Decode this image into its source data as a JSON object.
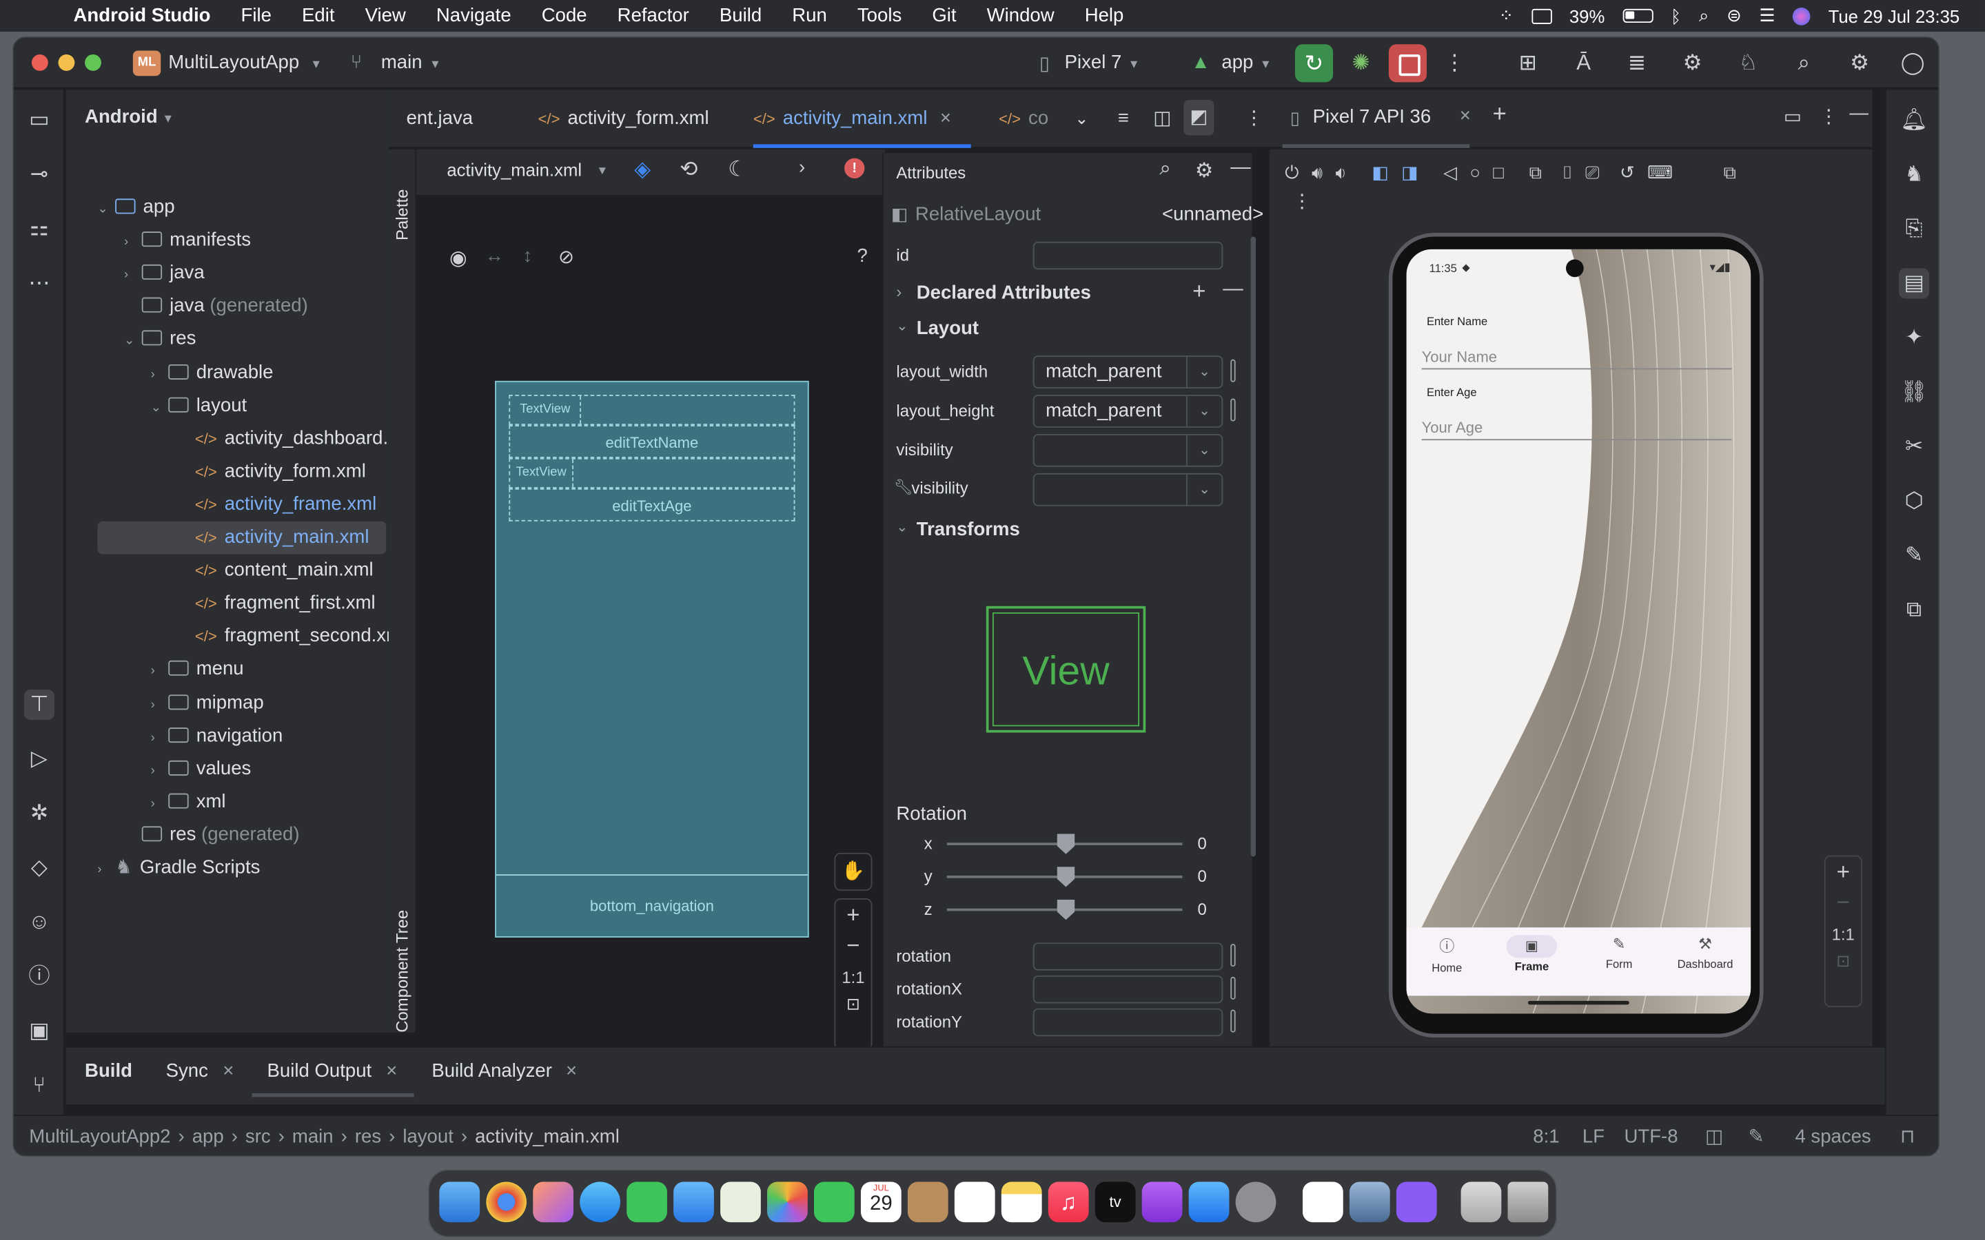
{
  "menubar": {
    "app_name": "Android Studio",
    "items": [
      "File",
      "Edit",
      "View",
      "Navigate",
      "Code",
      "Refactor",
      "Build",
      "Run",
      "Tools",
      "Git",
      "Window",
      "Help"
    ],
    "battery": "39%",
    "datetime": "Tue 29 Jul  23:35"
  },
  "titlebar": {
    "project_badge": "ML",
    "project_name": "MultiLayoutApp",
    "branch": "main",
    "device": "Pixel 7",
    "run_config": "app"
  },
  "project": {
    "view_mode": "Android",
    "tree": [
      {
        "label": "app",
        "indent": 0,
        "arrow": "open",
        "kind": "module"
      },
      {
        "label": "manifests",
        "indent": 1,
        "arrow": "closed",
        "kind": "folder"
      },
      {
        "label": "java",
        "indent": 1,
        "arrow": "closed",
        "kind": "folder"
      },
      {
        "label": "java",
        "suffix": " (generated)",
        "indent": 1,
        "arrow": "none",
        "kind": "folder"
      },
      {
        "label": "res",
        "indent": 1,
        "arrow": "open",
        "kind": "folder"
      },
      {
        "label": "drawable",
        "indent": 2,
        "arrow": "closed",
        "kind": "folder"
      },
      {
        "label": "layout",
        "indent": 2,
        "arrow": "open",
        "kind": "folder"
      },
      {
        "label": "activity_dashboard.x",
        "indent": 3,
        "arrow": "none",
        "kind": "xml"
      },
      {
        "label": "activity_form.xml",
        "indent": 3,
        "arrow": "none",
        "kind": "xml"
      },
      {
        "label": "activity_frame.xml",
        "indent": 3,
        "arrow": "none",
        "kind": "xml",
        "highlight": true
      },
      {
        "label": "activity_main.xml",
        "indent": 3,
        "arrow": "none",
        "kind": "xml",
        "selected": true
      },
      {
        "label": "content_main.xml",
        "indent": 3,
        "arrow": "none",
        "kind": "xml"
      },
      {
        "label": "fragment_first.xml",
        "indent": 3,
        "arrow": "none",
        "kind": "xml"
      },
      {
        "label": "fragment_second.xr",
        "indent": 3,
        "arrow": "none",
        "kind": "xml"
      },
      {
        "label": "menu",
        "indent": 2,
        "arrow": "closed",
        "kind": "folder"
      },
      {
        "label": "mipmap",
        "indent": 2,
        "arrow": "closed",
        "kind": "folder"
      },
      {
        "label": "navigation",
        "indent": 2,
        "arrow": "closed",
        "kind": "folder"
      },
      {
        "label": "values",
        "indent": 2,
        "arrow": "closed",
        "kind": "folder"
      },
      {
        "label": "xml",
        "indent": 2,
        "arrow": "closed",
        "kind": "folder"
      },
      {
        "label": "res",
        "suffix": " (generated)",
        "indent": 1,
        "arrow": "none",
        "kind": "folder"
      },
      {
        "label": "Gradle Scripts",
        "indent": 0,
        "arrow": "closed",
        "kind": "gradle"
      }
    ]
  },
  "editor_tabs": [
    {
      "label": "ent.java",
      "active": false
    },
    {
      "label": "activity_form.xml",
      "active": false
    },
    {
      "label": "activity_main.xml",
      "active": true
    },
    {
      "label": "co",
      "active": false
    }
  ],
  "design": {
    "file_select": "activity_main.xml",
    "palette_label": "Palette",
    "component_tree_label": "Component Tree",
    "zoom_label": "1:1",
    "help": "?",
    "blueprint": {
      "textview1": "TextView",
      "edit_name": "editTextName",
      "textview2": "TextView",
      "edit_age": "editTextAge",
      "bottom_nav": "bottom_navigation"
    }
  },
  "attributes": {
    "header": "Attributes",
    "component_type": "RelativeLayout",
    "component_name": "<unnamed>",
    "id_label": "id",
    "declared_section": "Declared Attributes",
    "layout_section": "Layout",
    "layout_width_label": "layout_width",
    "layout_width_value": "match_parent",
    "layout_height_label": "layout_height",
    "layout_height_value": "match_parent",
    "visibility_label": "visibility",
    "visibility_tool_label": "visibility",
    "transforms_section": "Transforms",
    "view_preview": "View",
    "rotation_title": "Rotation",
    "rot_x_label": "x",
    "rot_y_label": "y",
    "rot_z_label": "z",
    "rot_x_value": "0",
    "rot_y_value": "0",
    "rot_z_value": "0",
    "rotation_label": "rotation",
    "rotationX_label": "rotationX",
    "rotationY_label": "rotationY"
  },
  "emulator": {
    "tab_label": "Pixel 7 API 36",
    "zoom_label": "1:1",
    "phone": {
      "time": "11:35",
      "enter_name_label": "Enter Name",
      "name_hint": "Your Name",
      "enter_age_label": "Enter Age",
      "age_hint": "Your Age",
      "nav": [
        {
          "label": "Home",
          "icon": "info-icon",
          "active": false
        },
        {
          "label": "Frame",
          "icon": "image-icon",
          "active": true
        },
        {
          "label": "Form",
          "icon": "pencil-icon",
          "active": false
        },
        {
          "label": "Dashboard",
          "icon": "hammer-icon",
          "active": false
        }
      ]
    }
  },
  "bottom_panel": {
    "title": "Build",
    "tabs": [
      {
        "label": "Sync",
        "closable": true
      },
      {
        "label": "Build Output",
        "closable": true,
        "active": true
      },
      {
        "label": "Build Analyzer",
        "closable": true
      }
    ]
  },
  "statusbar": {
    "breadcrumbs": [
      "MultiLayoutApp2",
      "app",
      "src",
      "main",
      "res",
      "layout",
      "activity_main.xml"
    ],
    "position": "8:1",
    "line_sep": "LF",
    "encoding": "UTF-8",
    "indent": "4 spaces"
  },
  "dock": {
    "calendar_month": "JUL",
    "calendar_day": "29",
    "tv_label": "tv"
  },
  "colors": {
    "accent": "#3574f0",
    "blueprint": "#3c7280",
    "run_green": "#3b8f4d",
    "stop_red": "#c94f4f",
    "view_preview_green": "#4caf50"
  }
}
